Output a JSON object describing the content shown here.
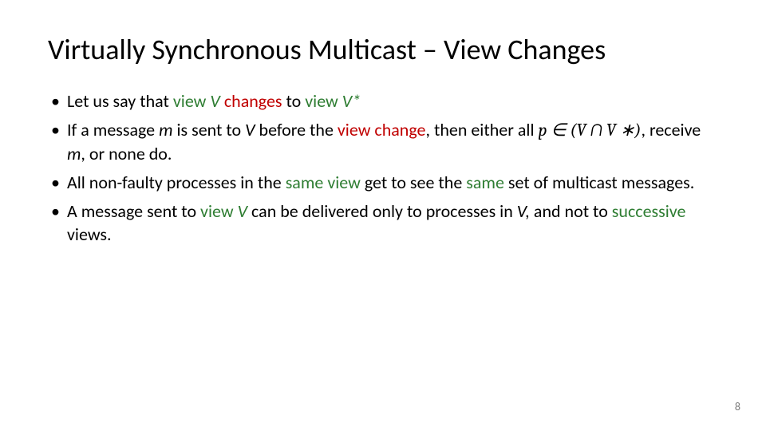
{
  "title": "Virtually Synchronous Multicast – View Changes",
  "bullets": {
    "b1": {
      "t1": "Let us say that ",
      "t2": "view ",
      "v": "V",
      "t3": " ",
      "changes": "changes",
      "t4": " to ",
      "t5": "view ",
      "vstar": "V*"
    },
    "b2": {
      "t1": "If a message ",
      "m": "m",
      "t2": " is sent to ",
      "v": "V",
      "t3": " before the ",
      "viewchange": "view change",
      "t4": ", then either all ",
      "math": "p ∈ (V ∩ V ∗)",
      "t5": ", receive ",
      "m2": "m",
      "t6": ", or none do."
    },
    "b3": {
      "t1": "All non-faulty processes in the ",
      "sameview": "same view",
      "t2": " get to see the ",
      "same": "same",
      "t3": " set of multicast messages."
    },
    "b4": {
      "t1": "A message sent to ",
      "vieww": "view ",
      "v": "V",
      "t2": " can be delivered only to processes in ",
      "v2": "V,",
      "t3": " and not to ",
      "successive": "successive",
      "t4": " views."
    }
  },
  "pagenum": "8"
}
